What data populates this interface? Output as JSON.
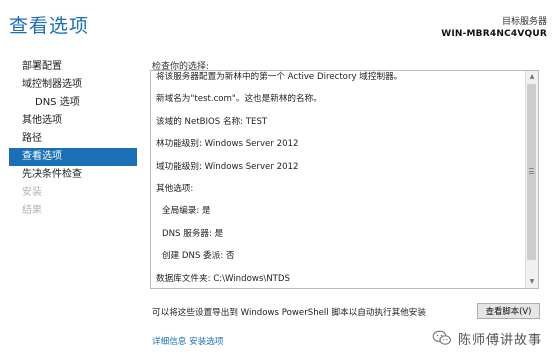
{
  "header": {
    "title": "查看选项",
    "target_server_label": "目标服务器",
    "target_server_name": "WIN-MBR4NC4VQUR"
  },
  "nav": {
    "items": [
      {
        "label": "部署配置",
        "state": "normal"
      },
      {
        "label": "域控制器选项",
        "state": "normal"
      },
      {
        "label": "DNS 选项",
        "state": "normal"
      },
      {
        "label": "其他选项",
        "state": "normal"
      },
      {
        "label": "路径",
        "state": "normal"
      },
      {
        "label": "查看选项",
        "state": "active"
      },
      {
        "label": "先决条件检查",
        "state": "normal"
      },
      {
        "label": "安装",
        "state": "disabled"
      },
      {
        "label": "结果",
        "state": "disabled"
      }
    ]
  },
  "review": {
    "label": "检查你的选择:",
    "lines": [
      "将该服务器配置为新林中的第一个 Active Directory 域控制器。",
      "新域名为\"test.com\"。这也是新林的名称。",
      "该域的 NetBIOS 名称: TEST",
      "林功能级别: Windows Server 2012",
      "域功能级别: Windows Server 2012",
      "其他选项:",
      "全局编录: 是",
      "DNS 服务器: 是",
      "创建 DNS 委派: 否",
      "数据库文件夹: C:\\Windows\\NTDS"
    ]
  },
  "footer": {
    "export_text": "可以将这些设置导出到 Windows PowerShell 脚本以自动执行其他安装",
    "view_script_label": "查看脚本(V)",
    "more_info_link": "详细信息 安装选项"
  },
  "watermark": {
    "text": "陈师傅讲故事"
  },
  "colors": {
    "accent": "#1a6fb7",
    "disabled_text": "#b3b3b3"
  }
}
